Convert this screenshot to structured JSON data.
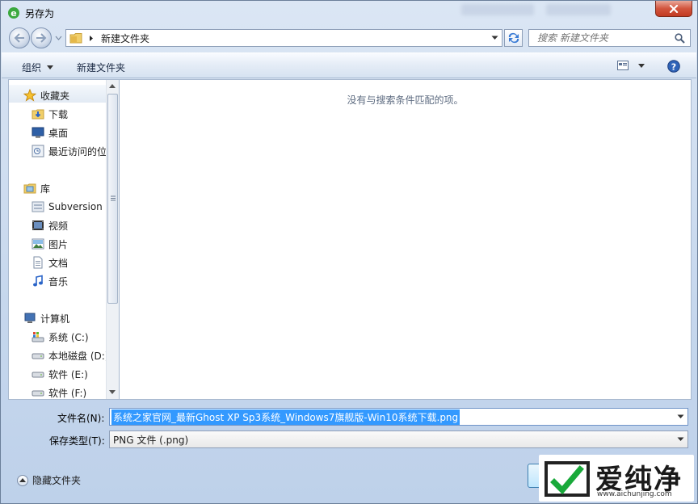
{
  "window": {
    "title": "另存为"
  },
  "address": {
    "path": "新建文件夹"
  },
  "search": {
    "placeholder": "搜索 新建文件夹"
  },
  "toolbar": {
    "organize": "组织",
    "new_folder": "新建文件夹"
  },
  "nav": {
    "groups": [
      {
        "label": "收藏夹",
        "icon": "star-icon",
        "items": [
          {
            "label": "下载",
            "icon": "downloads-folder-icon"
          },
          {
            "label": "桌面",
            "icon": "desktop-icon"
          },
          {
            "label": "最近访问的位置",
            "icon": "recent-places-icon"
          }
        ]
      },
      {
        "label": "库",
        "icon": "library-icon",
        "items": [
          {
            "label": "Subversion",
            "icon": "subversion-icon"
          },
          {
            "label": "视频",
            "icon": "video-icon"
          },
          {
            "label": "图片",
            "icon": "pictures-icon"
          },
          {
            "label": "文档",
            "icon": "documents-icon"
          },
          {
            "label": "音乐",
            "icon": "music-icon"
          }
        ]
      },
      {
        "label": "计算机",
        "icon": "computer-icon",
        "items": [
          {
            "label": "系统 (C:)",
            "icon": "system-drive-icon"
          },
          {
            "label": "本地磁盘 (D:)",
            "icon": "drive-icon"
          },
          {
            "label": "软件 (E:)",
            "icon": "drive-icon"
          },
          {
            "label": "软件 (F:)",
            "icon": "drive-icon"
          }
        ]
      }
    ]
  },
  "files": {
    "empty_message": "没有与搜索条件匹配的项。"
  },
  "form": {
    "filename_label": "文件名(N):",
    "filename_value": "系统之家官网_最新Ghost XP Sp3系统_Windows7旗舰版-Win10系统下载.png",
    "filetype_label": "保存类型(T):",
    "filetype_value": "PNG 文件 (.png)"
  },
  "footer": {
    "hide_folders": "隐藏文件夹"
  },
  "watermark": {
    "brand": "爱纯净",
    "url": "www.aichunjing.com"
  },
  "colors": {
    "selection": "#3399ff",
    "accent": "#3c7fb1",
    "close": "#c23b23",
    "watermark_green": "#19a93a"
  }
}
